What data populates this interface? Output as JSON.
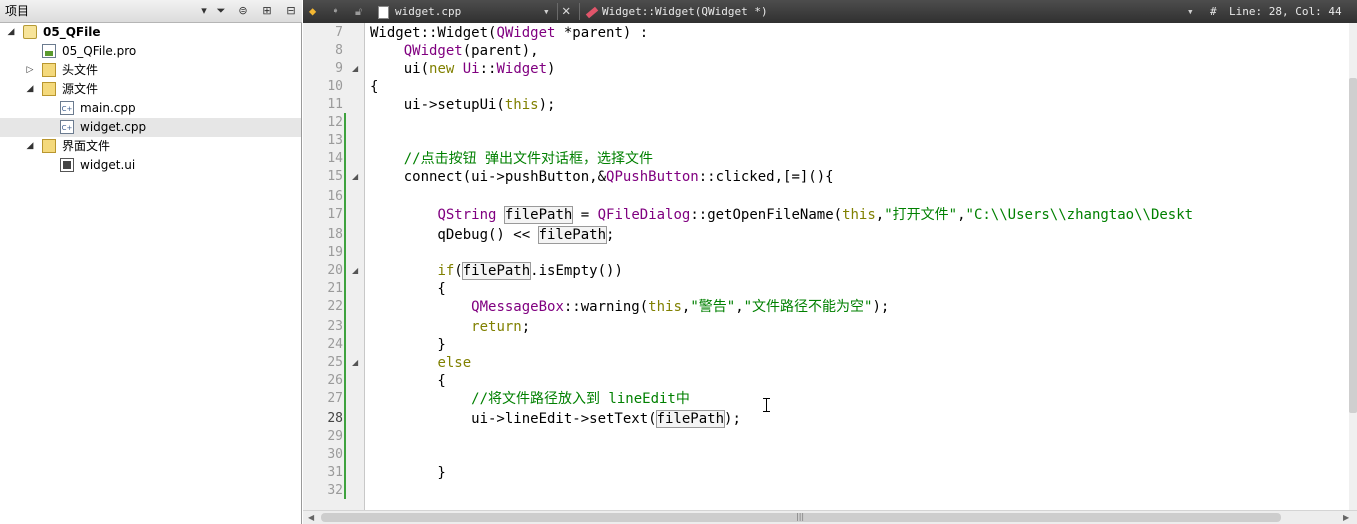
{
  "project_pane": {
    "title": "项目",
    "tree": [
      {
        "label": "05_QFile",
        "type": "project",
        "expanded": true
      },
      {
        "label": "05_QFile.pro",
        "type": "pro-file"
      },
      {
        "label": "头文件",
        "type": "folder",
        "expanded": false
      },
      {
        "label": "源文件",
        "type": "folder",
        "expanded": true
      },
      {
        "label": "main.cpp",
        "type": "cpp-file"
      },
      {
        "label": "widget.cpp",
        "type": "cpp-file",
        "selected": true
      },
      {
        "label": "界面文件",
        "type": "folder",
        "expanded": true
      },
      {
        "label": "widget.ui",
        "type": "ui-file"
      }
    ]
  },
  "editor": {
    "file_name": "widget.cpp",
    "symbol": "Widget::Widget(QWidget *)",
    "hash": "#",
    "position": "Line: 28, Col: 44",
    "current_line": 28,
    "line_numbers": [
      "7",
      "8",
      "9",
      "10",
      "11",
      "12",
      "13",
      "14",
      "15",
      "16",
      "17",
      "18",
      "19",
      "20",
      "21",
      "22",
      "23",
      "24",
      "25",
      "26",
      "27",
      "28",
      "29",
      "30",
      "31",
      "32"
    ]
  },
  "code_text": {
    "l7a": "Widget::Widget(",
    "l7b": "QWidget",
    "l7c": " *parent) :",
    "l8a": "    ",
    "l8b": "QWidget",
    "l8c": "(parent),",
    "l9a": "    ui(",
    "l9b": "new",
    "l9c": " ",
    "l9d": "Ui",
    "l9e": "::",
    "l9f": "Widget",
    "l9g": ")",
    "l10": "{",
    "l11a": "    ui->setupUi(",
    "l11b": "this",
    "l11c": ");",
    "l14": "    //点击按钮 弹出文件对话框，选择文件",
    "l15a": "    connect(ui->pushButton,&",
    "l15b": "QPushButton",
    "l15c": "::clicked,[=](){",
    "l17a": "        ",
    "l17b": "QString",
    "l17c": " ",
    "l17d": "filePath",
    "l17e": " = ",
    "l17f": "QFileDialog",
    "l17g": "::getOpenFileName(",
    "l17h": "this",
    "l17i": ",",
    "l17j": "\"打开文件\"",
    "l17k": ",",
    "l17l": "\"C:\\\\Users\\\\zhangtao\\\\Deskt",
    "l18a": "        qDebug() << ",
    "l18b": "filePath",
    "l18c": ";",
    "l20a": "        ",
    "l20b": "if",
    "l20c": "(",
    "l20d": "filePath",
    "l20e": ".isEmpty())",
    "l21": "        {",
    "l22a": "            ",
    "l22b": "QMessageBox",
    "l22c": "::warning(",
    "l22d": "this",
    "l22e": ",",
    "l22f": "\"警告\"",
    "l22g": ",",
    "l22h": "\"文件路径不能为空\"",
    "l22i": ");",
    "l23a": "            ",
    "l23b": "return",
    "l23c": ";",
    "l24": "        }",
    "l25a": "        ",
    "l25b": "else",
    "l26": "        {",
    "l27": "            //将文件路径放入到 lineEdit中",
    "l28a": "            ui->lineEdit->setText(",
    "l28b": "filePath",
    "l28c": ");",
    "l31": "        }"
  },
  "colors": {
    "type": "#800080",
    "keyword": "#808000",
    "string": "#008000",
    "comment": "#008000",
    "toolbar_bg": "#3a3a3a",
    "change_marker": "#3ea23e"
  },
  "icons": {
    "back": "arrow-left-icon",
    "forward": "arrow-right-icon",
    "lock": "lock-icon",
    "close": "close-icon",
    "filter": "filter-icon",
    "link": "link-icon",
    "split": "split-icon",
    "close_pane": "close-pane-icon"
  }
}
